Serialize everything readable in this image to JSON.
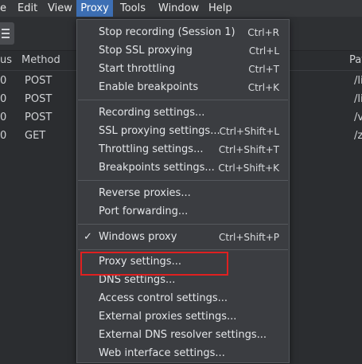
{
  "menubar": {
    "items": [
      {
        "label": "e"
      },
      {
        "label": "Edit"
      },
      {
        "label": "View"
      },
      {
        "label": "Proxy"
      },
      {
        "label": "Tools"
      },
      {
        "label": "Window"
      },
      {
        "label": "Help"
      }
    ],
    "active": "Proxy"
  },
  "toolbar": {
    "icon": "list-icon"
  },
  "table": {
    "columns": [
      {
        "label": "us"
      },
      {
        "label": "Method"
      },
      {
        "label": "Pat"
      }
    ],
    "rows": [
      {
        "status": "0",
        "method": "POST",
        "path": "/li"
      },
      {
        "status": "0",
        "method": "POST",
        "path": "/li"
      },
      {
        "status": "0",
        "method": "POST",
        "path": "/v"
      },
      {
        "status": "0",
        "method": "GET",
        "path": "/z"
      }
    ]
  },
  "proxy_menu": {
    "groups": [
      [
        {
          "label": "Stop recording (Session 1)",
          "shortcut": "Ctrl+R"
        },
        {
          "label": "Stop SSL proxying",
          "shortcut": "Ctrl+L"
        },
        {
          "label": "Start throttling",
          "shortcut": "Ctrl+T"
        },
        {
          "label": "Enable breakpoints",
          "shortcut": "Ctrl+K"
        }
      ],
      [
        {
          "label": "Recording settings...",
          "shortcut": ""
        },
        {
          "label": "SSL proxying settings...",
          "shortcut": "Ctrl+Shift+L"
        },
        {
          "label": "Throttling settings...",
          "shortcut": "Ctrl+Shift+T"
        },
        {
          "label": "Breakpoints settings...",
          "shortcut": "Ctrl+Shift+K"
        }
      ],
      [
        {
          "label": "Reverse proxies...",
          "shortcut": ""
        },
        {
          "label": "Port forwarding...",
          "shortcut": ""
        }
      ],
      [
        {
          "label": "Windows proxy",
          "shortcut": "Ctrl+Shift+P",
          "checked": true,
          "check_glyph": "✓"
        }
      ],
      [
        {
          "label": "Proxy settings...",
          "shortcut": ""
        },
        {
          "label": "DNS settings...",
          "shortcut": ""
        },
        {
          "label": "Access control settings...",
          "shortcut": ""
        },
        {
          "label": "External proxies settings...",
          "shortcut": ""
        },
        {
          "label": "External DNS resolver settings...",
          "shortcut": ""
        },
        {
          "label": "Web interface settings...",
          "shortcut": ""
        }
      ]
    ],
    "highlighted_item": "Proxy settings...",
    "highlight_color": "#e02020"
  },
  "colors": {
    "active_menu_bg": "#3d6fb4",
    "menu_bg": "#3b3d41",
    "window_bg": "#2b2d30"
  }
}
